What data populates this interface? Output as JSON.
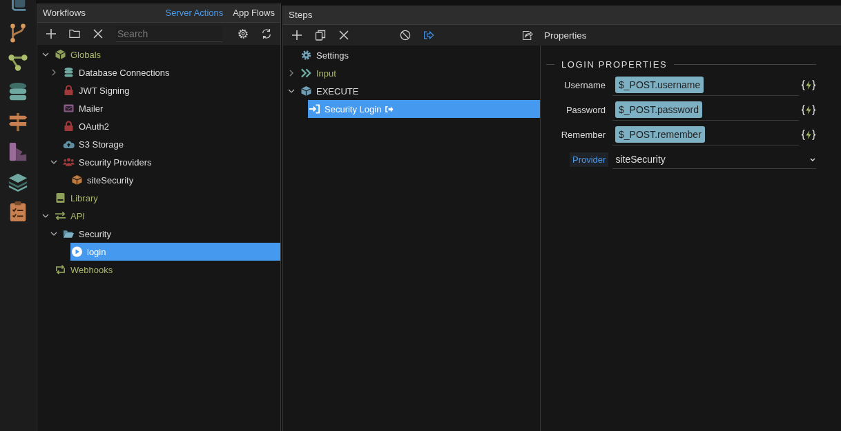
{
  "side_rail": {
    "icons": [
      {
        "kind": "page"
      },
      {
        "kind": "branch"
      },
      {
        "kind": "flow"
      },
      {
        "kind": "database"
      },
      {
        "kind": "signpost"
      },
      {
        "kind": "palette"
      },
      {
        "kind": "layers"
      },
      {
        "kind": "checklist"
      }
    ]
  },
  "workflows": {
    "title": "Workflows",
    "tabs": [
      {
        "label": "Server Actions",
        "selected": true
      },
      {
        "label": "App Flows",
        "selected": false
      }
    ],
    "search": {
      "placeholder": "Search"
    },
    "tree": [
      {
        "label": "Globals",
        "kind": "globals",
        "expanded": true,
        "selected": false,
        "children": [
          {
            "label": "Database Connections",
            "kind": "database",
            "expanded": false,
            "selected": false
          },
          {
            "label": "JWT Signing",
            "kind": "lock",
            "selected": false
          },
          {
            "label": "Mailer",
            "kind": "mail",
            "selected": false
          },
          {
            "label": "OAuth2",
            "kind": "lock",
            "selected": false
          },
          {
            "label": "S3 Storage",
            "kind": "cloud",
            "selected": false
          },
          {
            "label": "Security Providers",
            "kind": "users",
            "expanded": true,
            "selected": false,
            "children": [
              {
                "label": "siteSecurity",
                "kind": "box",
                "selected": false
              }
            ]
          }
        ]
      },
      {
        "label": "Library",
        "kind": "library",
        "selected": false
      },
      {
        "label": "API",
        "kind": "api",
        "expanded": true,
        "selected": false,
        "children": [
          {
            "label": "Security",
            "kind": "folder",
            "expanded": true,
            "selected": false,
            "children": [
              {
                "label": "login",
                "kind": "action",
                "selected": true
              }
            ]
          }
        ]
      },
      {
        "label": "Webhooks",
        "kind": "webhooks",
        "selected": false
      }
    ]
  },
  "steps": {
    "title": "Steps",
    "tree": [
      {
        "label": "Settings",
        "kind": "settings",
        "selected": false
      },
      {
        "label": "Input",
        "kind": "input",
        "expanded": false,
        "selected": false
      },
      {
        "label": "EXECUTE",
        "kind": "execute",
        "expanded": true,
        "selected": false,
        "children": [
          {
            "label": "Security Login",
            "kind": "login",
            "selected": true
          }
        ]
      }
    ]
  },
  "properties": {
    "title": "Properties",
    "section": "LOGIN PROPERTIES",
    "fields": [
      {
        "kind": "binding",
        "label": "Username",
        "value": "$_POST.username"
      },
      {
        "kind": "binding",
        "label": "Password",
        "value": "$_POST.password"
      },
      {
        "kind": "binding",
        "label": "Remember",
        "value": "$_POST.remember"
      },
      {
        "kind": "select",
        "label": "Provider",
        "value": "siteSecurity"
      }
    ]
  }
}
